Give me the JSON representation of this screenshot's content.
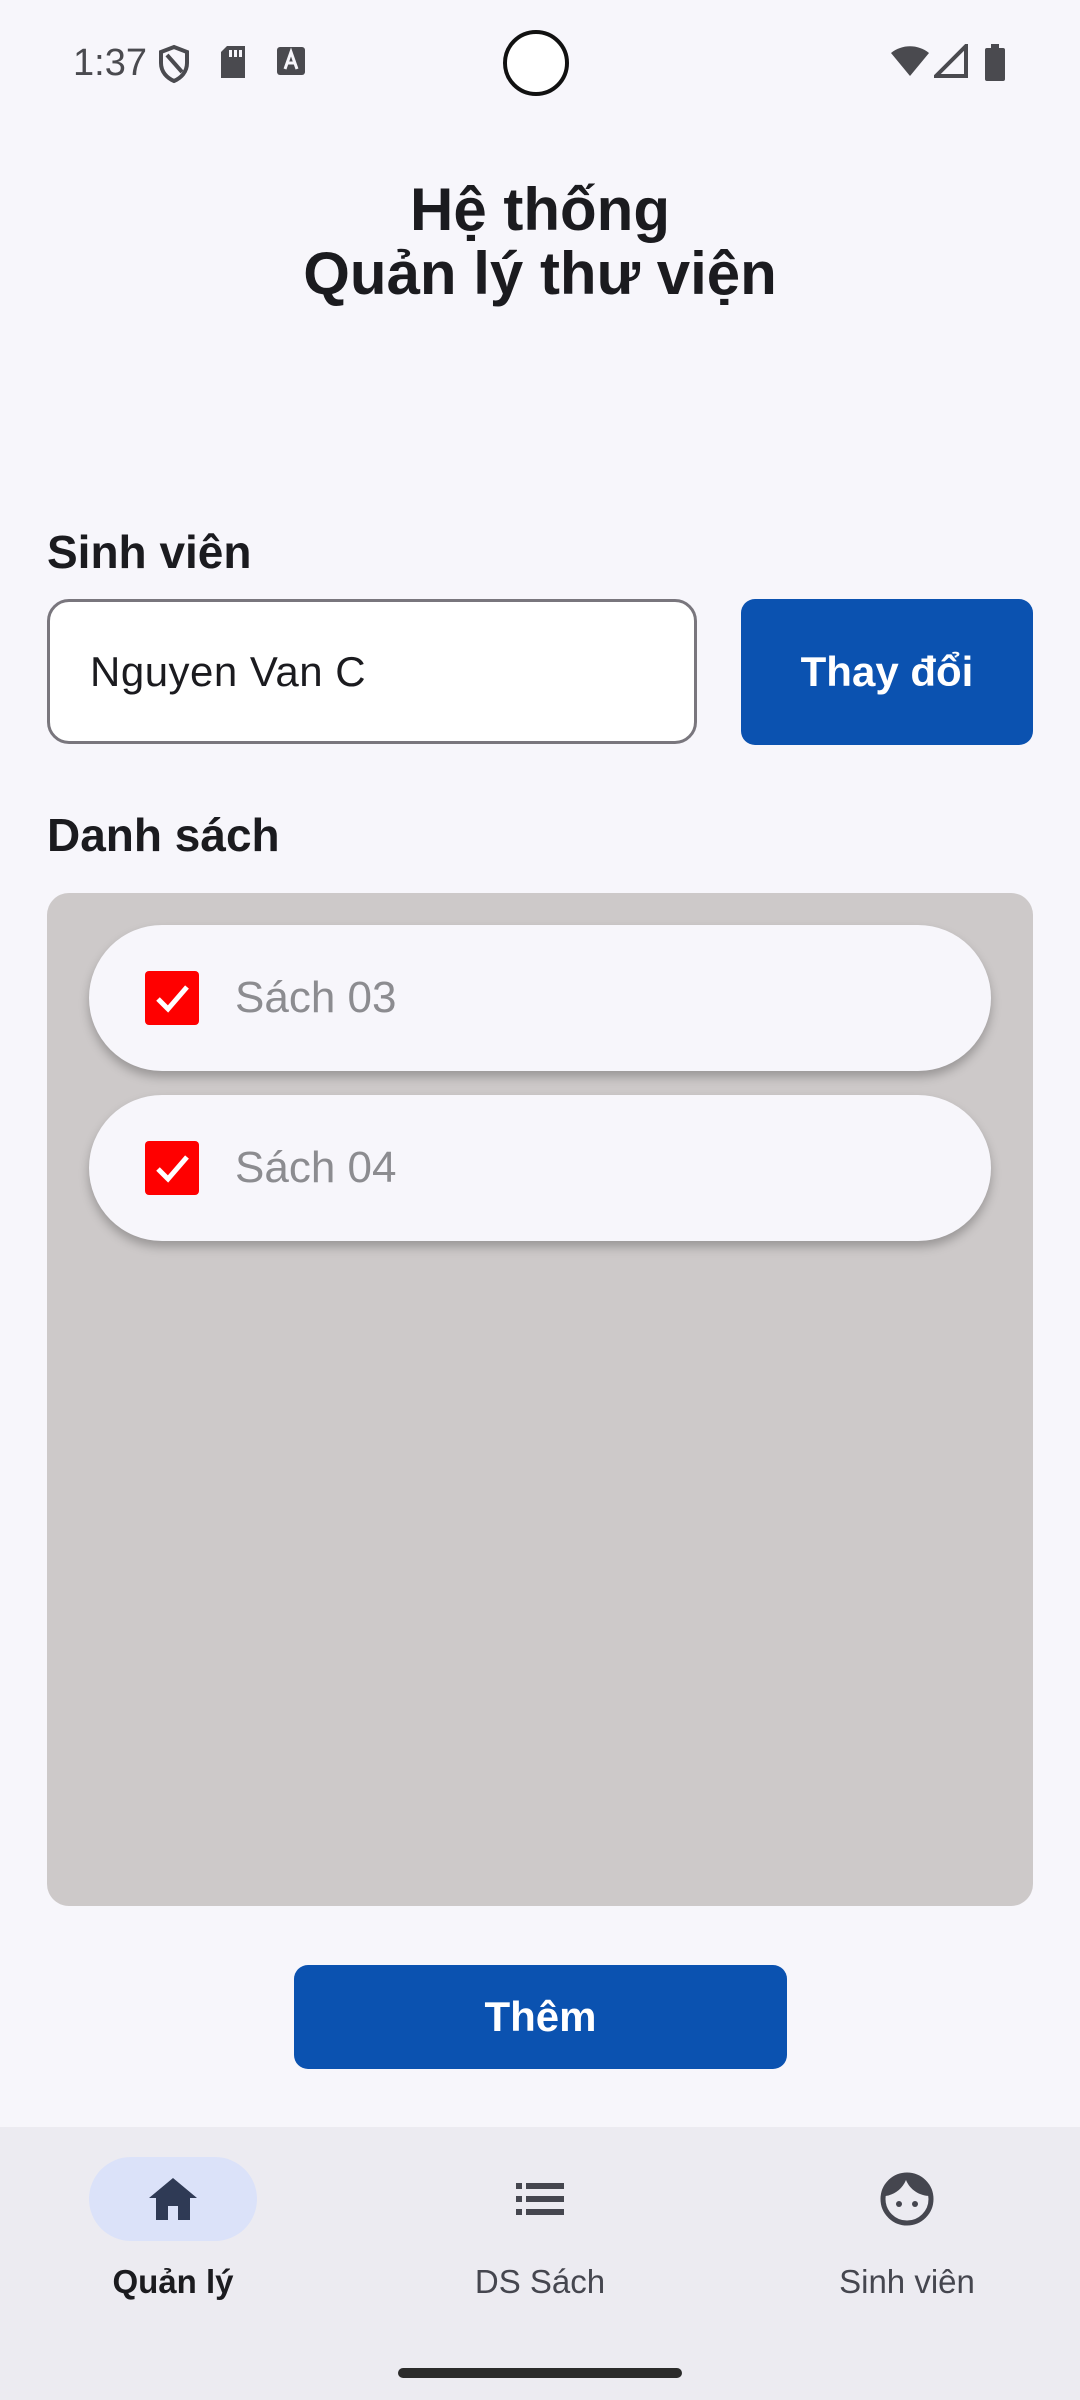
{
  "status_bar": {
    "time": "1:37",
    "icons_left": [
      "shield-icon",
      "sd-card-icon",
      "text-a-icon"
    ],
    "icons_right": [
      "wifi-icon",
      "signal-icon",
      "battery-icon"
    ]
  },
  "header": {
    "title_line1": "Hệ thống",
    "title_line2": "Quản lý thư viện"
  },
  "student": {
    "label": "Sinh viên",
    "name_value": "Nguyen Van C",
    "change_button": "Thay đổi"
  },
  "list": {
    "label": "Danh sách",
    "items": [
      {
        "label": "Sách 03",
        "checked": true
      },
      {
        "label": "Sách 04",
        "checked": true
      }
    ]
  },
  "actions": {
    "add_button": "Thêm"
  },
  "bottom_nav": {
    "items": [
      {
        "label": "Quản lý",
        "icon": "home-icon",
        "active": true
      },
      {
        "label": "DS Sách",
        "icon": "list-icon",
        "active": false
      },
      {
        "label": "Sinh viên",
        "icon": "face-icon",
        "active": false
      }
    ]
  },
  "colors": {
    "primary": "#0b52b0",
    "checkbox": "#ff0000",
    "panel": "#cdc9c9",
    "background": "#f7f6fb",
    "nav_background": "#ecebf1",
    "nav_active_pill": "#dbe2f9"
  }
}
